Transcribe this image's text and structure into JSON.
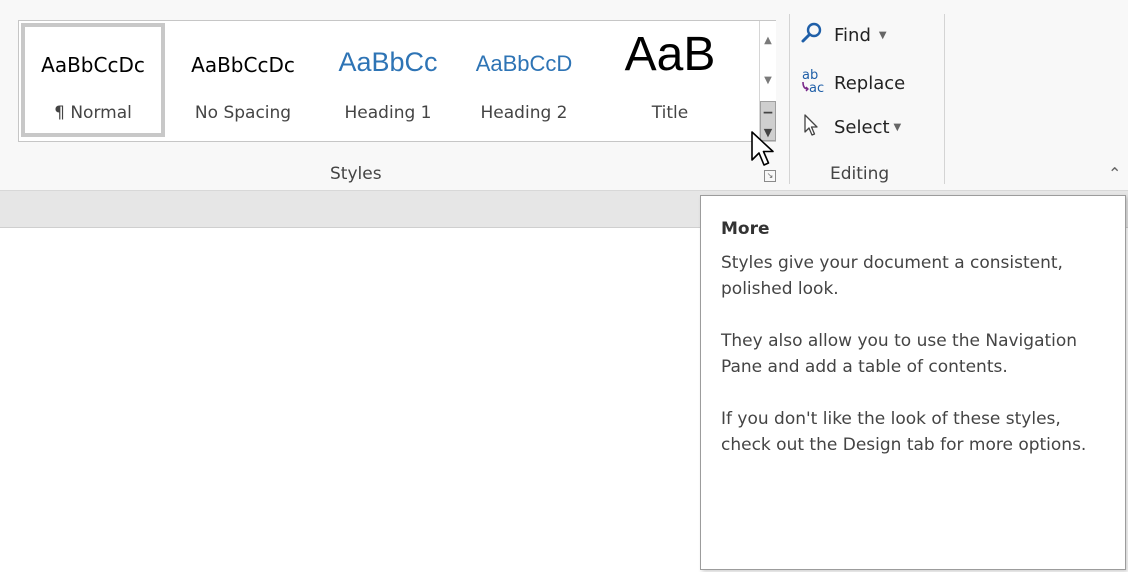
{
  "ribbon": {
    "styles": {
      "group_label": "Styles",
      "items": [
        {
          "sample": "AaBbCcDc",
          "label": "¶ Normal",
          "selected": true
        },
        {
          "sample": "AaBbCcDc",
          "label": "No Spacing",
          "selected": false
        },
        {
          "sample": "AaBbCc",
          "label": "Heading 1",
          "selected": false
        },
        {
          "sample": "AaBbCcD",
          "label": "Heading 2",
          "selected": false
        },
        {
          "sample": "AaB",
          "label": "Title",
          "selected": false
        }
      ]
    },
    "editing": {
      "group_label": "Editing",
      "find_label": "Find",
      "replace_label": "Replace",
      "select_label": "Select"
    }
  },
  "tooltip": {
    "title": "More",
    "paragraphs": [
      "Styles give your document a consistent, polished look.",
      "They also allow you to use the Navigation Pane and add a table of contents.",
      "If you don't like the look of these styles, check out the Design tab for more options."
    ]
  },
  "colors": {
    "heading_blue": "#2e74b5",
    "ribbon_bg": "#f8f8f8",
    "tooltip_text": "#444444"
  },
  "icons": {
    "find": "search-icon",
    "replace": "replace-icon",
    "select": "select-pointer-icon"
  }
}
